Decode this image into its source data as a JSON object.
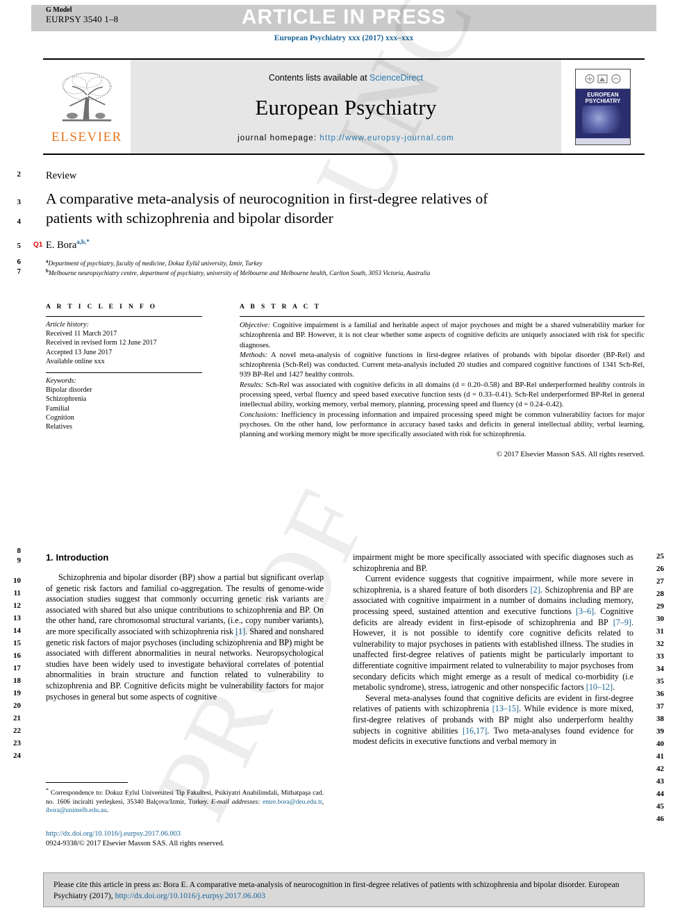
{
  "header": {
    "g_model_label": "G Model",
    "article_code": "EURPSY 3540 1–8",
    "banner": "ARTICLE IN PRESS",
    "running_head": "European Psychiatry xxx (2017) xxx–xxx"
  },
  "masthead": {
    "publisher_name": "ELSEVIER",
    "contents_prefix": "Contents lists available at ",
    "contents_link": "ScienceDirect",
    "journal_title": "European Psychiatry",
    "homepage_prefix": "journal homepage: ",
    "homepage_url": "http://www.europsy-journal.com",
    "cover_title": "EUROPEAN PSYCHIATRY"
  },
  "article": {
    "doctype": "Review",
    "title": "A comparative meta-analysis of neurocognition in first-degree relatives of patients with schizophrenia and bipolar disorder",
    "query_marker": "Q1",
    "author": "E. Bora",
    "author_marks": "a,b,*",
    "affiliation_a_sup": "a",
    "affiliation_a": "Department of psychiatry, faculty of medicine, Dokuz Eylül university, Izmir, Turkey",
    "affiliation_b_sup": "b",
    "affiliation_b": "Melbourne neuropsychiatry centre, department of psychiatry, university of Melbourne and Melbourne health, Carlton South, 3053 Victoria, Australia"
  },
  "info": {
    "heading": "A R T I C L E  I N F O",
    "history_label": "Article history:",
    "history": [
      "Received 11 March 2017",
      "Received in revised form 12 June 2017",
      "Accepted 13 June 2017",
      "Available online xxx"
    ],
    "keywords_label": "Keywords:",
    "keywords": [
      "Bipolar disorder",
      "Schizophrenia",
      "Familial",
      "Cognition",
      "Relatives"
    ]
  },
  "abstract": {
    "heading": "A B S T R A C T",
    "objective_label": "Objective:",
    "objective": " Cognitive impairment is a familial and heritable aspect of major psychoses and might be a shared vulnerability marker for schizophrenia and BP. However, it is not clear whether some aspects of cognitive deficits are uniquely associated with risk for specific diagnoses.",
    "methods_label": "Methods:",
    "methods": " A novel meta-analysis of cognitive functions in first-degree relatives of probands with bipolar disorder (BP-Rel) and schizophrenia (Sch-Rel) was conducted. Current meta-analysis included 20 studies and compared cognitive functions of 1341 Sch-Rel, 939 BP-Rel and 1427 healthy controls.",
    "results_label": "Results:",
    "results": " Sch-Rel was associated with cognitive deficits in all domains (d = 0.20–0.58) and BP-Rel underperformed healthy controls in processing speed, verbal fluency and speed based executive function tests (d = 0.33–0.41). Sch-Rel underperformed BP-Rel in general intellectual ability, working memory, verbal memory, planning, processing speed and fluency (d = 0.24–0.42).",
    "conclusions_label": "Conclusions:",
    "conclusions": " Inefficiency in processing information and impaired processing speed might be common vulnerability factors for major psychoses. On the other hand, low performance in accuracy based tasks and deficits in general intellectual ability, verbal learning, planning and working memory might be more specifically associated with risk for schizophrenia.",
    "copyright": "© 2017 Elsevier Masson SAS. All rights reserved."
  },
  "body": {
    "section_title": "1. Introduction",
    "left_para_1": "Schizophrenia and bipolar disorder (BP) show a partial but significant overlap of genetic risk factors and familial co-aggregation. The results of genome-wide association studies suggest that commonly occurring genetic risk variants are associated with shared but also unique contributions to schizophrenia and BP. On the other hand, rare chromosomal structural variants, (i.e., copy number variants), are more specifically associated with schizophrenia risk ",
    "left_ref_1": "[1]",
    "left_para_1b": ". Shared and nonshared genetic risk factors of major psychoses (including schizophrenia and BP) might be associated with different abnormalities in neural networks. Neuropsychological studies have been widely used to investigate behavioral correlates of potential abnormalities in brain structure and function related to vulnerability to schizophrenia and BP. Cognitive deficits might be vulnerability factors for major psychoses in general but some aspects of cognitive",
    "right_para_0": "impairment might be more specifically associated with specific diagnoses such as schizophrenia and BP.",
    "right_para_1a": "Current evidence suggests that cognitive impairment, while more severe in schizophrenia, is a shared feature of both disorders ",
    "right_ref_2": "[2]",
    "right_para_1b": ". Schizophrenia and BP are associated with cognitive impairment in a number of domains including memory, processing speed, sustained attention and executive functions ",
    "right_ref_36": "[3–6]",
    "right_para_1c": ". Cognitive deficits are already evident in first-episode of schizophrenia and BP ",
    "right_ref_79": "[7–9]",
    "right_para_1d": ". However, it is not possible to identify core cognitive deficits related to vulnerability to major psychoses in patients with established illness. The studies in unaffected first-degree relatives of patients might be particularly important to differentiate cognitive impairment related to vulnerability to major psychoses from secondary deficits which might emerge as a result of medical co-morbidity (i.e metabolic syndrome), stress, iatrogenic and other nonspecific factors ",
    "right_ref_1012": "[10–12]",
    "right_para_1e": ".",
    "right_para_2a": "Several meta-analyses found that cognitive deficits are evident in first-degree relatives of patients with schizophrenia ",
    "right_ref_1315": "[13–15]",
    "right_para_2b": ". While evidence is more mixed, first-degree relatives of probands with BP might also underperform healthy subjects in cognitive abilities ",
    "right_ref_1617": "[16,17]",
    "right_para_2c": ". Two meta-analyses found evidence for modest deficits in executive functions and verbal memory in"
  },
  "line_numbers": {
    "top_left": [
      "2",
      "3",
      "4",
      "5",
      "6",
      "7"
    ],
    "left": [
      "8",
      "9",
      "10",
      "11",
      "12",
      "13",
      "14",
      "15",
      "16",
      "17",
      "18",
      "19",
      "20",
      "21",
      "22",
      "23",
      "24"
    ],
    "right": [
      "25",
      "26",
      "27",
      "28",
      "29",
      "30",
      "31",
      "32",
      "33",
      "34",
      "35",
      "36",
      "37",
      "38",
      "39",
      "40",
      "41",
      "42",
      "43",
      "44",
      "45",
      "46"
    ]
  },
  "footnote": {
    "marker": "*",
    "text": " Correspondence to: Dokuz Eylul Universitesi Tip Fakultesi, Psikiyatri Anabilimdali, Mithatpaşa cad. no. 1606 inciralti yerleşkesi, 35340 Balçova/Izmir, Turkey.",
    "email_label": "E-mail addresses:",
    "email_1": "emre.bora@deu.edu.tr",
    "email_sep": ", ",
    "email_2": "ibora@unimelb.edu.au",
    "email_end": "."
  },
  "doi_block": {
    "doi_url": "http://dx.doi.org/10.1016/j.eurpsy.2017.06.003",
    "issn_line": "0924-9338/© 2017 Elsevier Masson SAS. All rights reserved."
  },
  "cite_box": {
    "text_before": "Please cite this article in press as: Bora E. A comparative meta-analysis of neurocognition in first-degree relatives of patients with schizophrenia and bipolar disorder. European Psychiatry (2017), ",
    "link": "http://dx.doi.org/10.1016/j.eurpsy.2017.06.003"
  },
  "watermark": {
    "line1": "UNCORRECTED",
    "line2": "PROOF"
  },
  "colors": {
    "link_blue": "#1a6496",
    "elsevier_orange": "#E87722",
    "query_red": "#e00000",
    "band_gray": "#c9c9c9",
    "masthead_gray": "#e6e6e6",
    "cite_gray": "#d9d9d9"
  }
}
